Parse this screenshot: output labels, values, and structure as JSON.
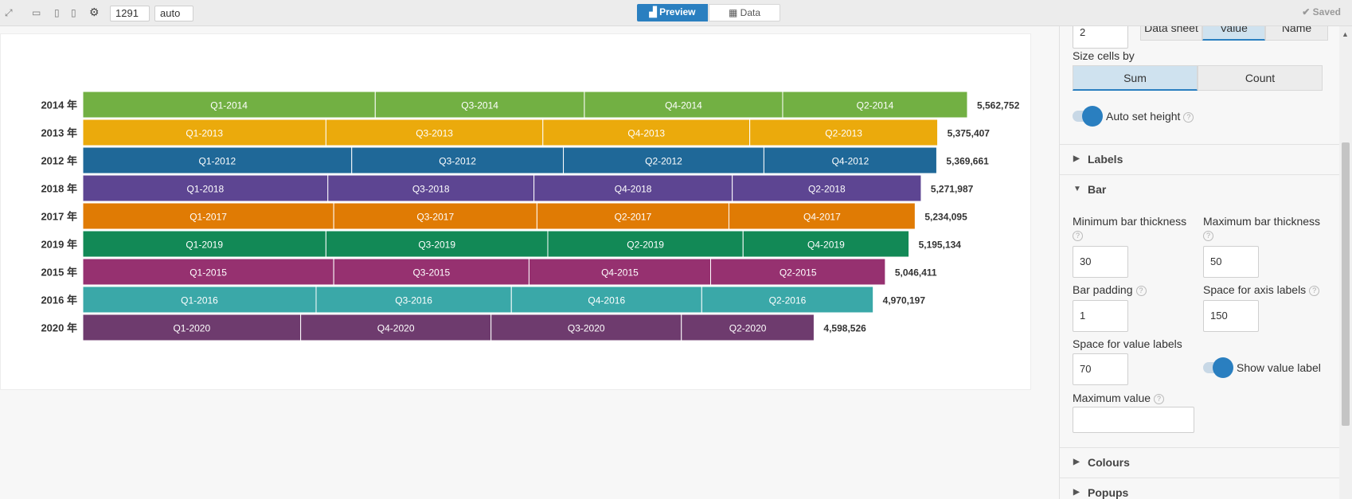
{
  "toolbar": {
    "width_value": "1291",
    "height_value": "auto",
    "preview_label": "Preview",
    "data_label": "Data",
    "saved_label": "Saved"
  },
  "colors": {
    "accent": "#2a7fc0",
    "2014": "#72b043",
    "2013": "#ebaa0c",
    "2012": "#1f6898",
    "2018": "#5d4592",
    "2017": "#e07b04",
    "2019": "#128956",
    "2015": "#963170",
    "2016": "#3aa8a8",
    "2020": "#6e3b6e"
  },
  "chart_data": {
    "type": "bar",
    "stacked": true,
    "orientation": "horizontal",
    "rows": [
      {
        "label": "2014 年",
        "total_label": "5,562,752",
        "total": 5562752,
        "color": "#72b043",
        "segments": [
          {
            "name": "Q1-2014",
            "value": 1839000
          },
          {
            "name": "Q3-2014",
            "value": 1315000
          },
          {
            "name": "Q4-2014",
            "value": 1247000
          },
          {
            "name": "Q2-2014",
            "value": 1161752
          }
        ]
      },
      {
        "label": "2013 年",
        "total_label": "5,375,407",
        "total": 5375407,
        "color": "#ebaa0c",
        "segments": [
          {
            "name": "Q1-2013",
            "value": 1529000
          },
          {
            "name": "Q3-2013",
            "value": 1364000
          },
          {
            "name": "Q4-2013",
            "value": 1301000
          },
          {
            "name": "Q2-2013",
            "value": 1181407
          }
        ]
      },
      {
        "label": "2012 年",
        "total_label": "5,369,661",
        "total": 5369661,
        "color": "#1f6898",
        "segments": [
          {
            "name": "Q1-2012",
            "value": 1691000
          },
          {
            "name": "Q3-2012",
            "value": 1331000
          },
          {
            "name": "Q2-2012",
            "value": 1261000
          },
          {
            "name": "Q4-2012",
            "value": 1086661
          }
        ]
      },
      {
        "label": "2018 年",
        "total_label": "5,271,987",
        "total": 5271987,
        "color": "#5d4592",
        "segments": [
          {
            "name": "Q1-2018",
            "value": 1541000
          },
          {
            "name": "Q3-2018",
            "value": 1296000
          },
          {
            "name": "Q4-2018",
            "value": 1247000
          },
          {
            "name": "Q2-2018",
            "value": 1187987
          }
        ]
      },
      {
        "label": "2017 年",
        "total_label": "5,234,095",
        "total": 5234095,
        "color": "#e07b04",
        "segments": [
          {
            "name": "Q1-2017",
            "value": 1578000
          },
          {
            "name": "Q3-2017",
            "value": 1278000
          },
          {
            "name": "Q2-2017",
            "value": 1207000
          },
          {
            "name": "Q4-2017",
            "value": 1171095
          }
        ]
      },
      {
        "label": "2019 年",
        "total_label": "5,195,134",
        "total": 5195134,
        "color": "#128956",
        "segments": [
          {
            "name": "Q1-2019",
            "value": 1529000
          },
          {
            "name": "Q3-2019",
            "value": 1395000
          },
          {
            "name": "Q2-2019",
            "value": 1228000
          },
          {
            "name": "Q4-2019",
            "value": 1043134
          }
        ]
      },
      {
        "label": "2015 年",
        "total_label": "5,046,411",
        "total": 5046411,
        "color": "#963170",
        "segments": [
          {
            "name": "Q1-2015",
            "value": 1578000
          },
          {
            "name": "Q3-2015",
            "value": 1228000
          },
          {
            "name": "Q4-2015",
            "value": 1142000
          },
          {
            "name": "Q2-2015",
            "value": 1098411
          }
        ]
      },
      {
        "label": "2016 年",
        "total_label": "4,970,197",
        "total": 4970197,
        "color": "#3aa8a8",
        "segments": [
          {
            "name": "Q1-2016",
            "value": 1467000
          },
          {
            "name": "Q3-2016",
            "value": 1228000
          },
          {
            "name": "Q4-2016",
            "value": 1197000
          },
          {
            "name": "Q2-2016",
            "value": 1078197
          }
        ]
      },
      {
        "label": "2020 年",
        "total_label": "4,598,526",
        "total": 4598526,
        "color": "#6e3b6e",
        "segments": [
          {
            "name": "Q1-2020",
            "value": 1370000
          },
          {
            "name": "Q4-2020",
            "value": 1197000
          },
          {
            "name": "Q3-2020",
            "value": 1197000
          },
          {
            "name": "Q2-2020",
            "value": 834526
          }
        ]
      }
    ]
  },
  "panel": {
    "top_input_value": "2",
    "tabs": [
      {
        "label": "Data sheet"
      },
      {
        "label": "Value"
      },
      {
        "label": "Name"
      }
    ],
    "size_cells_by_label": "Size cells by",
    "size_options": [
      {
        "label": "Sum",
        "active": true
      },
      {
        "label": "Count",
        "active": false
      }
    ],
    "auto_set_height_label": "Auto set height",
    "labels_section": "Labels",
    "bar_section": "Bar",
    "min_bar_thickness_label": "Minimum bar thickness",
    "min_bar_thickness_value": "30",
    "max_bar_thickness_label": "Maximum bar thickness",
    "max_bar_thickness_value": "50",
    "bar_padding_label": "Bar padding",
    "bar_padding_value": "1",
    "space_axis_labels_label": "Space for axis labels",
    "space_axis_labels_value": "150",
    "space_value_labels_label": "Space for value labels",
    "space_value_labels_value": "70",
    "show_value_label": "Show value label",
    "maximum_value_label": "Maximum value",
    "maximum_value_value": "",
    "colours_section": "Colours",
    "popups_section": "Popups"
  }
}
